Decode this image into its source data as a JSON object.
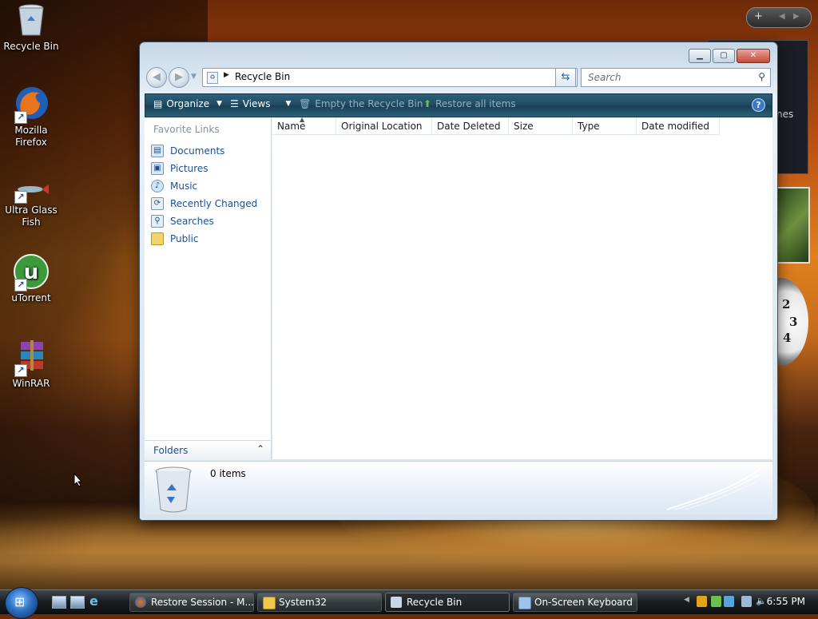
{
  "desktop": {
    "icons": [
      {
        "label_line1": "Recycle Bin",
        "label_line2": ""
      },
      {
        "label_line1": "Mozilla",
        "label_line2": "Firefox"
      },
      {
        "label_line1": "Ultra Glass",
        "label_line2": "Fish"
      },
      {
        "label_line1": "uTorrent",
        "label_line2": ""
      },
      {
        "label_line1": "WinRAR",
        "label_line2": ""
      }
    ],
    "gadget_media_text": "nes",
    "clock_numbers": [
      "2",
      "3",
      "4"
    ]
  },
  "window": {
    "address": "Recycle Bin",
    "search_placeholder": "Search",
    "toolbar": {
      "organize": "Organize",
      "views": "Views",
      "empty": "Empty the Recycle Bin",
      "restore": "Restore all items",
      "help": "?"
    },
    "nav_pane": {
      "heading": "Favorite Links",
      "links": [
        "Documents",
        "Pictures",
        "Music",
        "Recently Changed",
        "Searches",
        "Public"
      ],
      "folders": "Folders"
    },
    "columns": [
      "Name",
      "Original Location",
      "Date Deleted",
      "Size",
      "Type",
      "Date modified"
    ],
    "details": {
      "items_text": "0 items"
    }
  },
  "taskbar": {
    "tasks": [
      {
        "label": "Restore Session - M..."
      },
      {
        "label": "System32"
      },
      {
        "label": "Recycle Bin"
      },
      {
        "label": "On-Screen Keyboard"
      }
    ],
    "clock": "6:55 PM"
  },
  "colors": {
    "link_blue": "#1e4f93",
    "toolbar_teal": "#1f4c63",
    "taskbar_dark": "#1a1f22"
  }
}
